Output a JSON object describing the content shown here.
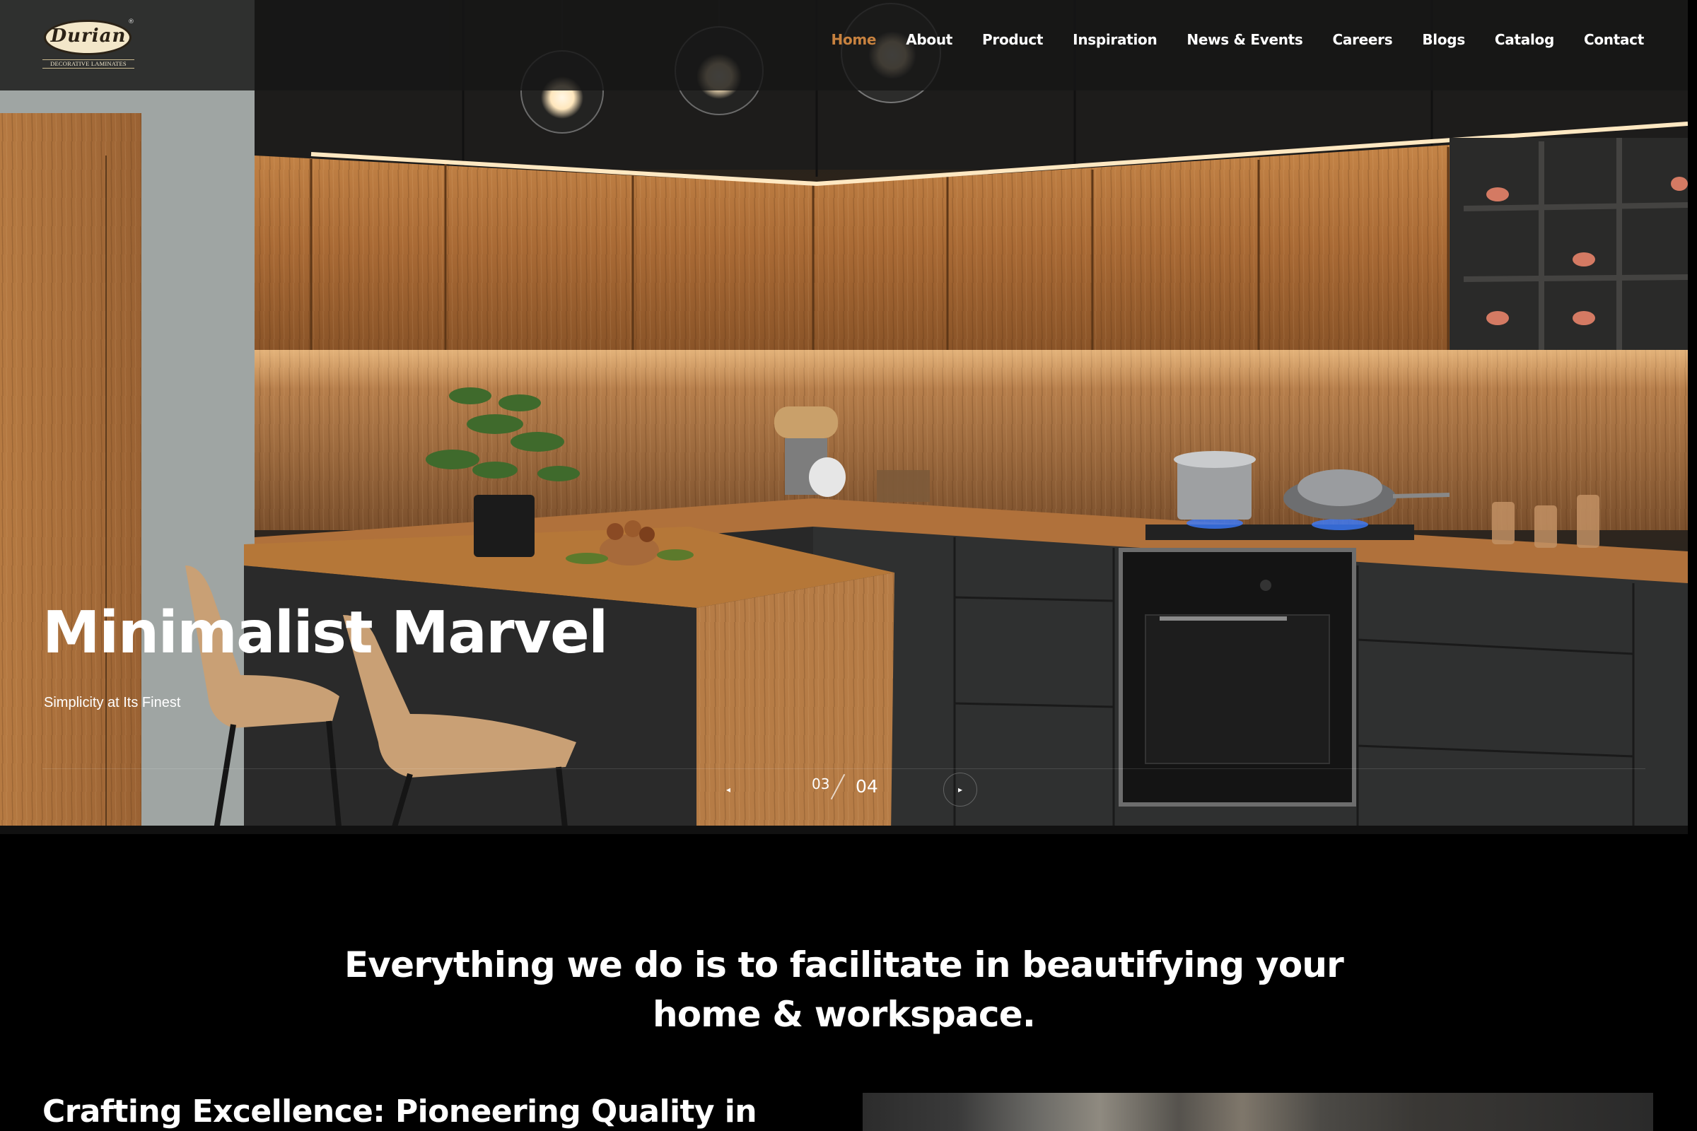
{
  "brand": {
    "logo_word": "Durian",
    "logo_tagline": "DECORATIVE LAMINATES",
    "logo_reg": "®"
  },
  "nav": {
    "items": [
      {
        "label": "Home",
        "active": true
      },
      {
        "label": "About"
      },
      {
        "label": "Product"
      },
      {
        "label": "Inspiration"
      },
      {
        "label": "News & Events"
      },
      {
        "label": "Careers"
      },
      {
        "label": "Blogs"
      },
      {
        "label": "Catalog"
      },
      {
        "label": "Contact"
      }
    ],
    "active_color": "#c8823f"
  },
  "hero": {
    "title": "Minimalist Marvel",
    "subtitle": "Simplicity at Its Finest",
    "slide_current": "03",
    "slide_total": "04",
    "prev_icon": "◂",
    "next_icon": "▸"
  },
  "intro": {
    "line1": "Everything we do is to facilitate in beautifying your",
    "line2": "home & workspace."
  },
  "section": {
    "heading": "Crafting Excellence: Pioneering Quality in"
  }
}
